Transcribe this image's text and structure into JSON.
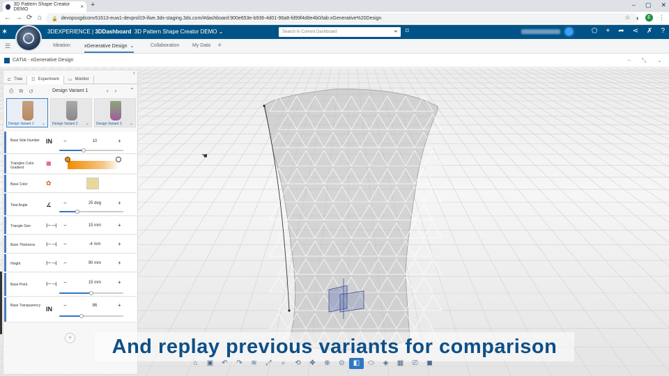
{
  "browser": {
    "tab_title": "3D Pattern Shape Creator DEMO",
    "tab_close": "×",
    "new_tab": "+",
    "url": "devopsxgdconv51613-euw1-devprol19-ifwe.3dx-staging.3ds.com/#dashboard:900e653e-b936-4d01-96a8-fd99f4d8e4b0/tab:xGenerative%20Design",
    "profile_initial": "E",
    "window_controls": [
      "–",
      "▢",
      "✕"
    ],
    "nav": {
      "back": "←",
      "forward": "→",
      "reload": "⟳",
      "home": "⌂"
    }
  },
  "dashboard": {
    "brand": "3DEXPERIENCE",
    "app": "3DDashboard",
    "title": "3D Pattern Shape Creator DEMO",
    "search_placeholder": "Search In Current Dashboard",
    "tabs": [
      "Ideation",
      "xGenerative Design",
      "Collaboration",
      "My Data"
    ],
    "active_tab": "xGenerative Design",
    "accent": "#005386"
  },
  "app_header": {
    "title": "CATIA - xGenerative Design"
  },
  "panel": {
    "tabs": [
      "Tree",
      "Experiment",
      "Monitor"
    ],
    "active_tab": "Experiment",
    "variant_name": "Design Variant 1",
    "thumbnails": [
      "Design Variant 1",
      "Design Variant 2",
      "Design Variant 3"
    ],
    "params": [
      {
        "label": "Base Side Number",
        "icon": "IN",
        "value": "10",
        "level": 0.38
      },
      {
        "label": "Triangles Color Gradient"
      },
      {
        "label": "Base Color"
      },
      {
        "label": "Total Angle",
        "value": "25 deg",
        "level": 0.28
      },
      {
        "label": "Triangle Size",
        "value": "15 mm"
      },
      {
        "label": "Base Thickness",
        "value": "-4 mm"
      },
      {
        "label": "Height",
        "value": "90 mm"
      },
      {
        "label": "Base Point",
        "value": "15 mm",
        "level": 0.5
      },
      {
        "label": "Base Transparency",
        "icon": "IN",
        "value": "86",
        "level": 0.35
      }
    ]
  },
  "caption": "And replay previous variants for comparison",
  "toolbar_icons": [
    "home-icon",
    "save-icon",
    "undo-icon",
    "redo-icon",
    "wifi-icon",
    "fit-icon",
    "zoom-area-icon",
    "rotate-icon",
    "pan-icon",
    "zoom-icon",
    "normal-view-icon",
    "cube-view-icon",
    "shading-icon",
    "render-icon",
    "grid-icon",
    "capture-icon",
    "box-icon"
  ]
}
